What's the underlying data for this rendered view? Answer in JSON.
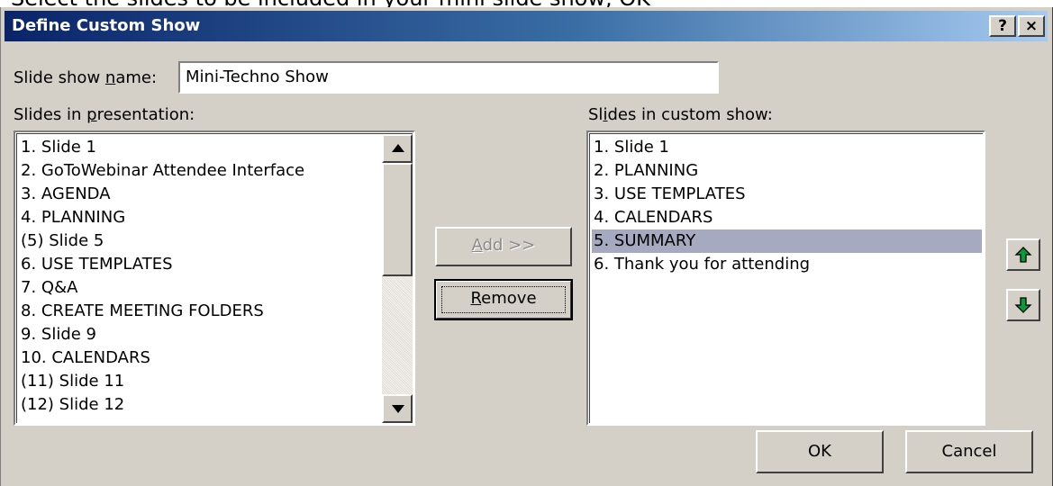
{
  "caption": "Select the slides to be included in your mini slide show, OK",
  "dialog": {
    "title": "Define Custom Show",
    "help_label": "?",
    "close_label": "×"
  },
  "name_field": {
    "label_pre": "Slide show ",
    "label_accel": "n",
    "label_post": "ame:",
    "value": "Mini-Techno Show"
  },
  "presentation_list": {
    "label_pre": "Slides in ",
    "label_accel": "p",
    "label_post": "resentation:",
    "items": [
      "1. Slide 1",
      "2. GoToWebinar Attendee Interface",
      "3. AGENDA",
      "4. PLANNING",
      "(5) Slide 5",
      "6. USE TEMPLATES",
      "7. Q&A",
      "8. CREATE MEETING FOLDERS",
      "9. Slide 9",
      "10. CALENDARS",
      "(11) Slide 11",
      "(12) Slide 12"
    ]
  },
  "custom_list": {
    "label_pre": "Sl",
    "label_accel": "i",
    "label_post": "des in custom show:",
    "items": [
      "1. Slide 1",
      "2. PLANNING",
      "3. USE TEMPLATES",
      "4. CALENDARS",
      "5. SUMMARY",
      "6. Thank you for attending"
    ],
    "selected_index": 4
  },
  "buttons": {
    "add_accel": "A",
    "add_rest": "dd >>",
    "remove_accel": "R",
    "remove_rest": "emove",
    "ok": "OK",
    "cancel": "Cancel",
    "move_up_icon": "green-up-arrow-icon",
    "move_down_icon": "green-down-arrow-icon"
  },
  "colors": {
    "selection": "#a6aac0",
    "dialog_face": "#d4d0c8",
    "title_start": "#0a246a",
    "title_end": "#a6caf0",
    "arrow_green": "#0a9a3a"
  }
}
